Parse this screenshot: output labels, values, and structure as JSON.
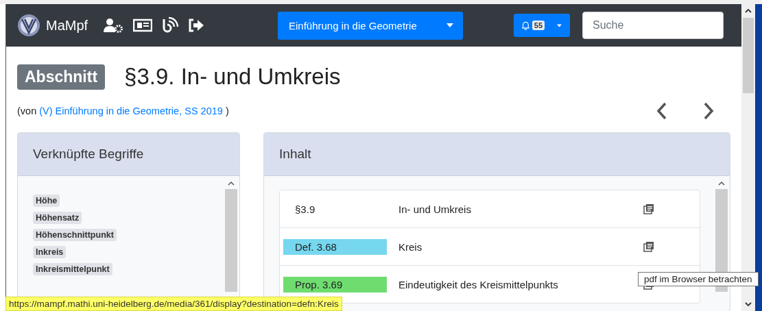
{
  "navbar": {
    "brand": "MaMpf",
    "course_dropdown": "Einführung in die Geometrie",
    "notifications": "55",
    "search": {
      "placeholder": "Suche"
    }
  },
  "heading": {
    "badge": "Abschnitt",
    "title": "§3.9. In- und Umkreis"
  },
  "source": {
    "prefix": "(von",
    "link": "(V) Einführung in die Geometrie, SS 2019",
    "suffix": ")"
  },
  "tags_card": {
    "title": "Verknüpfte Begriffe",
    "tags": [
      "Höhe",
      "Höhensatz",
      "Höhenschnittpunkt",
      "Inkreis",
      "Inkreismittelpunkt"
    ]
  },
  "content_card": {
    "title": "Inhalt",
    "rows": [
      {
        "label": "§3.9",
        "title": "In- und Umkreis"
      },
      {
        "label": "Def. 3.68",
        "color": "#76d7ee",
        "title": "Kreis"
      },
      {
        "label": "Prop. 3.69",
        "color": "#6fdc6f",
        "title": "Eindeutigkeit des Kreismittelpunkts"
      }
    ]
  },
  "tooltip": "pdf im Browser betrachten",
  "status_bar": "https://mampf.mathi.uni-heidelberg.de/media/361/display?destination=defn:Kreis"
}
